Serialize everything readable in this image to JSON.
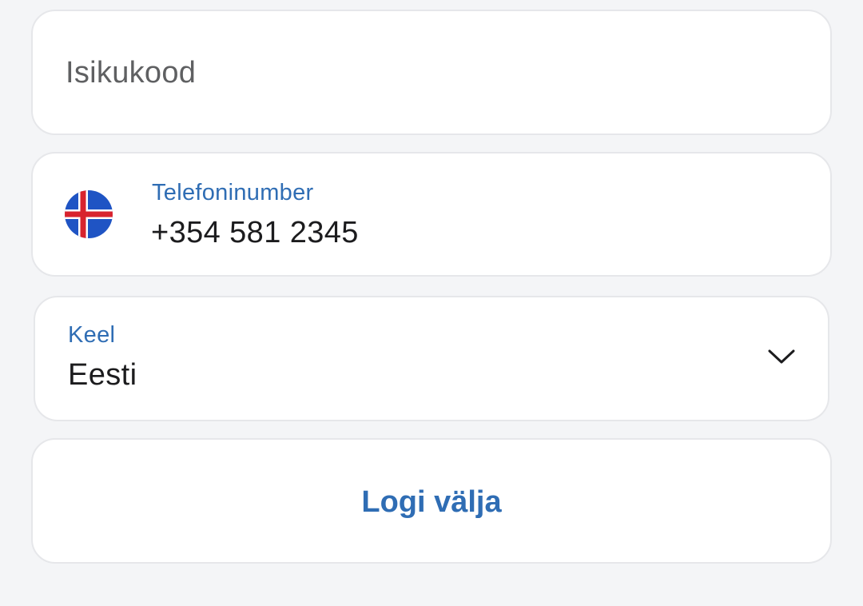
{
  "national_id_field": {
    "placeholder": "Isikukood",
    "value": ""
  },
  "phone_field": {
    "label": "Telefoninumber",
    "value": "+354 581 2345",
    "country_flag_icon": "iceland-flag-icon"
  },
  "language_select": {
    "label": "Keel",
    "selected": "Eesti",
    "icon": "chevron-down-icon"
  },
  "logout_button": {
    "label": "Logi välja"
  },
  "colors": {
    "background": "#f4f5f7",
    "card": "#ffffff",
    "card_border": "#e6e7ea",
    "accent": "#2f6db4",
    "text_primary": "#1c1c1e",
    "text_placeholder": "#5f6062",
    "flag_blue": "#1f54c4",
    "flag_red": "#d8232e"
  }
}
